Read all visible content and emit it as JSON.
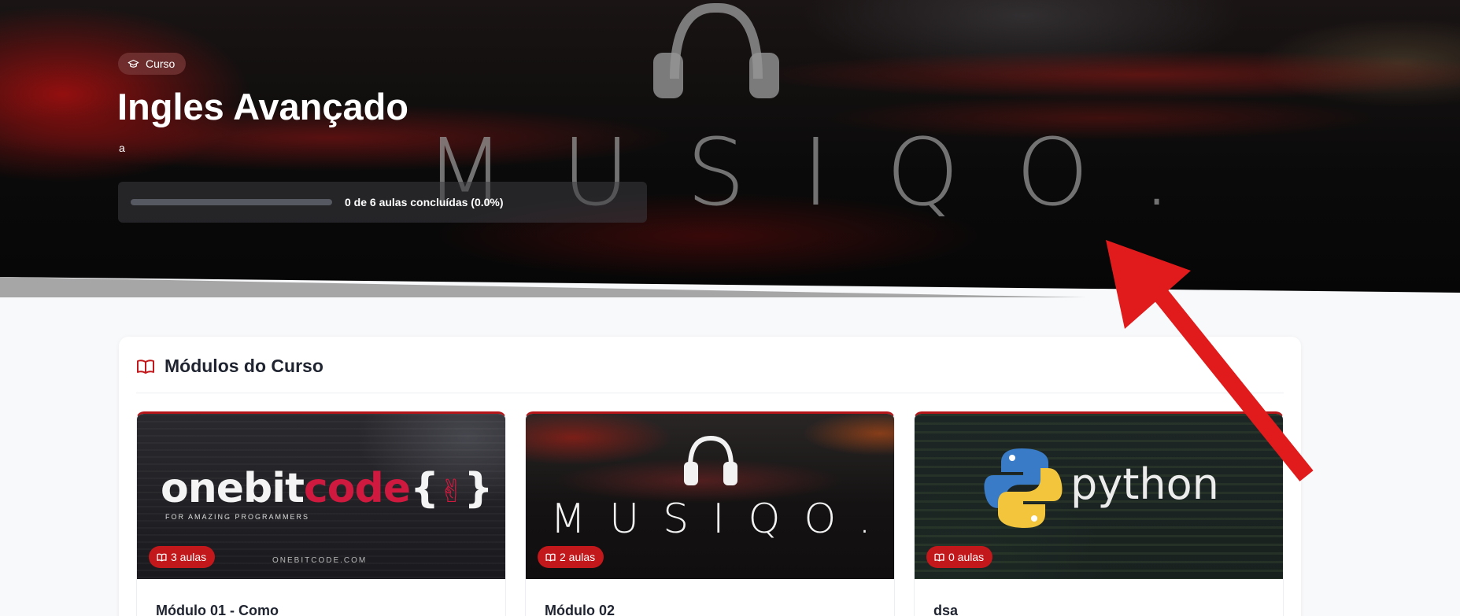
{
  "hero": {
    "badge_label": "Curso",
    "title": "Ingles Avançado",
    "description": "a",
    "logo_text": "MUSIQO.",
    "progress": {
      "fraction": 0.0,
      "text": "0 de 6 aulas concluídas (0.0%)"
    }
  },
  "modules": {
    "section_title": "Módulos do Curso",
    "items": [
      {
        "title": "Módulo 01 - Como",
        "lesson_count": "3 aulas",
        "thumb_brand": "onebitcode",
        "thumb_brand_braces": "{",
        "thumb_brand_braces_close": "}",
        "thumb_tagline": "FOR AMAZING PROGRAMMERS",
        "thumb_site": "ONEBITCODE.COM"
      },
      {
        "title": "Módulo 02",
        "lesson_count": "2 aulas",
        "thumb_brand": "MUSIQO."
      },
      {
        "title": "dsa",
        "lesson_count": "0 aulas",
        "thumb_brand": "python"
      }
    ]
  },
  "colors": {
    "accent": "#c2181b",
    "arrow": "#e11b1b"
  }
}
